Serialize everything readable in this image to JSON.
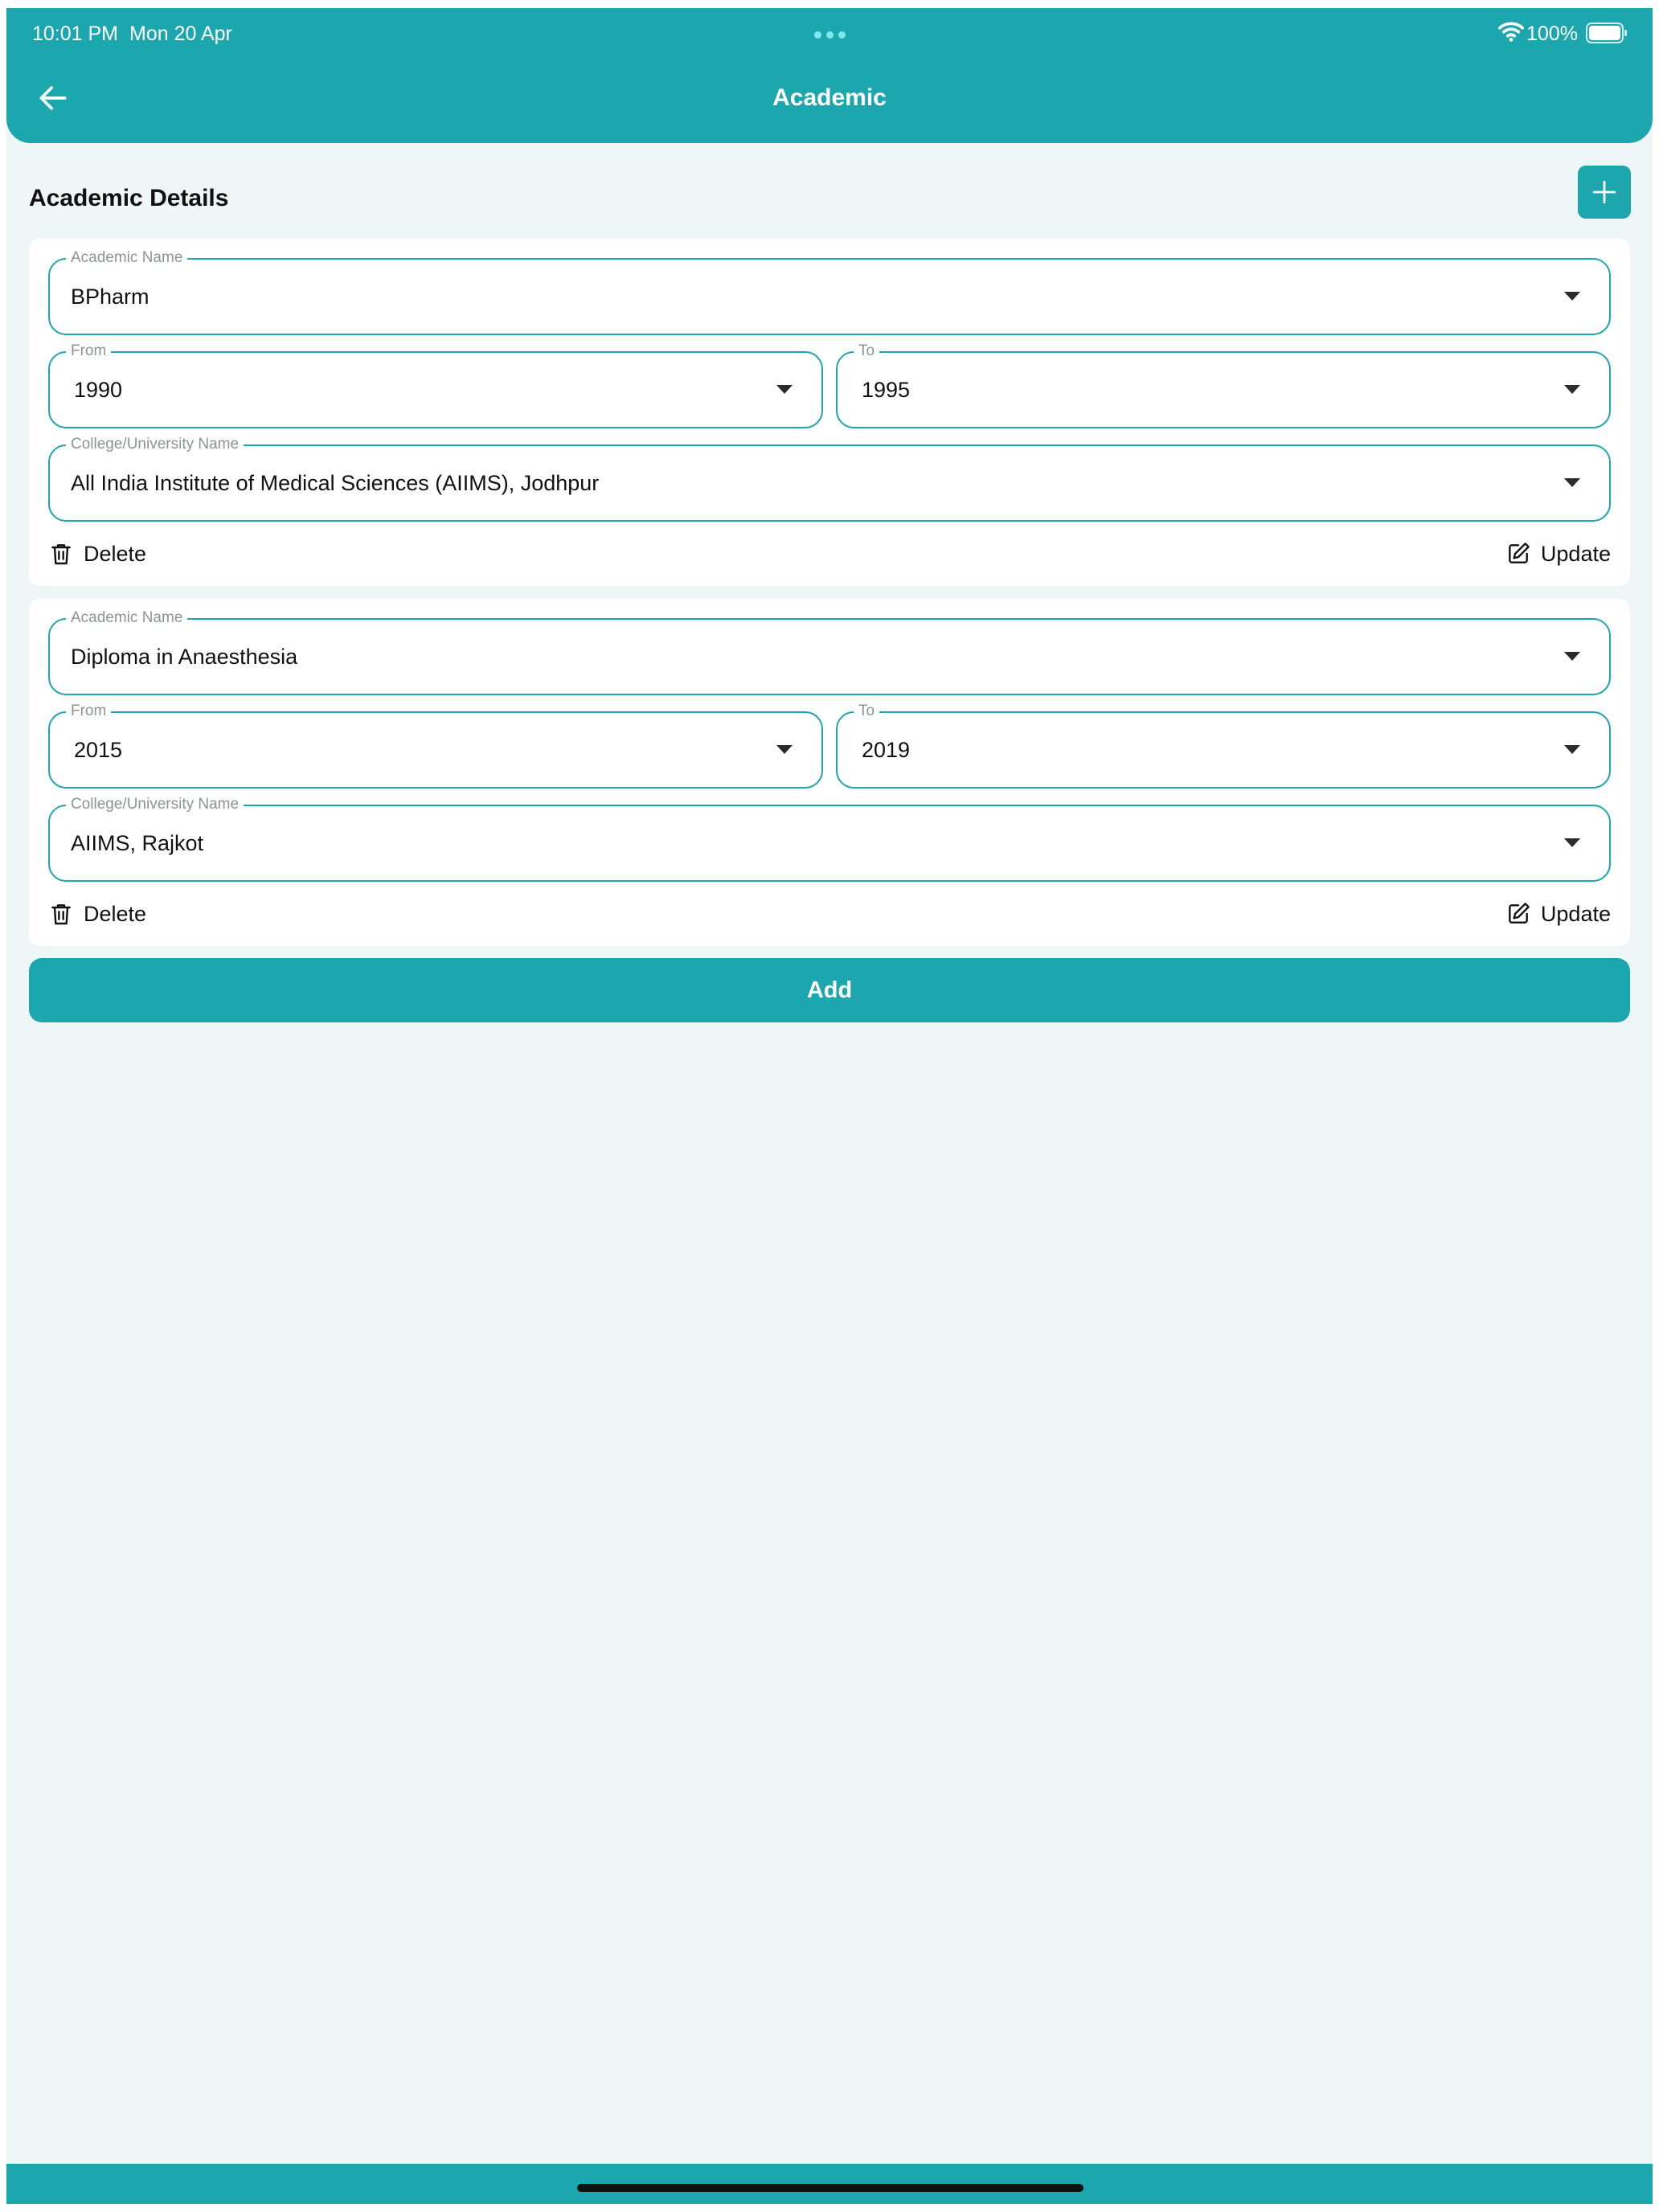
{
  "status_bar": {
    "time": "10:01 PM",
    "date": "Mon 20 Apr",
    "battery": "100%"
  },
  "header": {
    "title": "Academic",
    "back_icon": "arrow-left-icon"
  },
  "section": {
    "title": "Academic Details",
    "add_icon": "plus-icon"
  },
  "records": [
    {
      "academic_name_label": "Academic Name",
      "academic_name": "BPharm",
      "from_label": "From",
      "from": "1990",
      "to_label": "To",
      "to": "1995",
      "college_label": "College/University Name",
      "college": "All India Institute of Medical Sciences (AIIMS), Jodhpur",
      "delete_label": "Delete",
      "update_label": "Update"
    },
    {
      "academic_name_label": "Academic Name",
      "academic_name": "Diploma in Anaesthesia",
      "from_label": "From",
      "from": "2015",
      "to_label": "To",
      "to": "2019",
      "college_label": "College/University Name",
      "college": "AIIMS, Rajkot",
      "delete_label": "Delete",
      "update_label": "Update"
    }
  ],
  "add_button": {
    "label": "Add"
  },
  "colors": {
    "primary": "#1ca6ae",
    "background": "#eef6f7",
    "card": "#ffffff"
  }
}
